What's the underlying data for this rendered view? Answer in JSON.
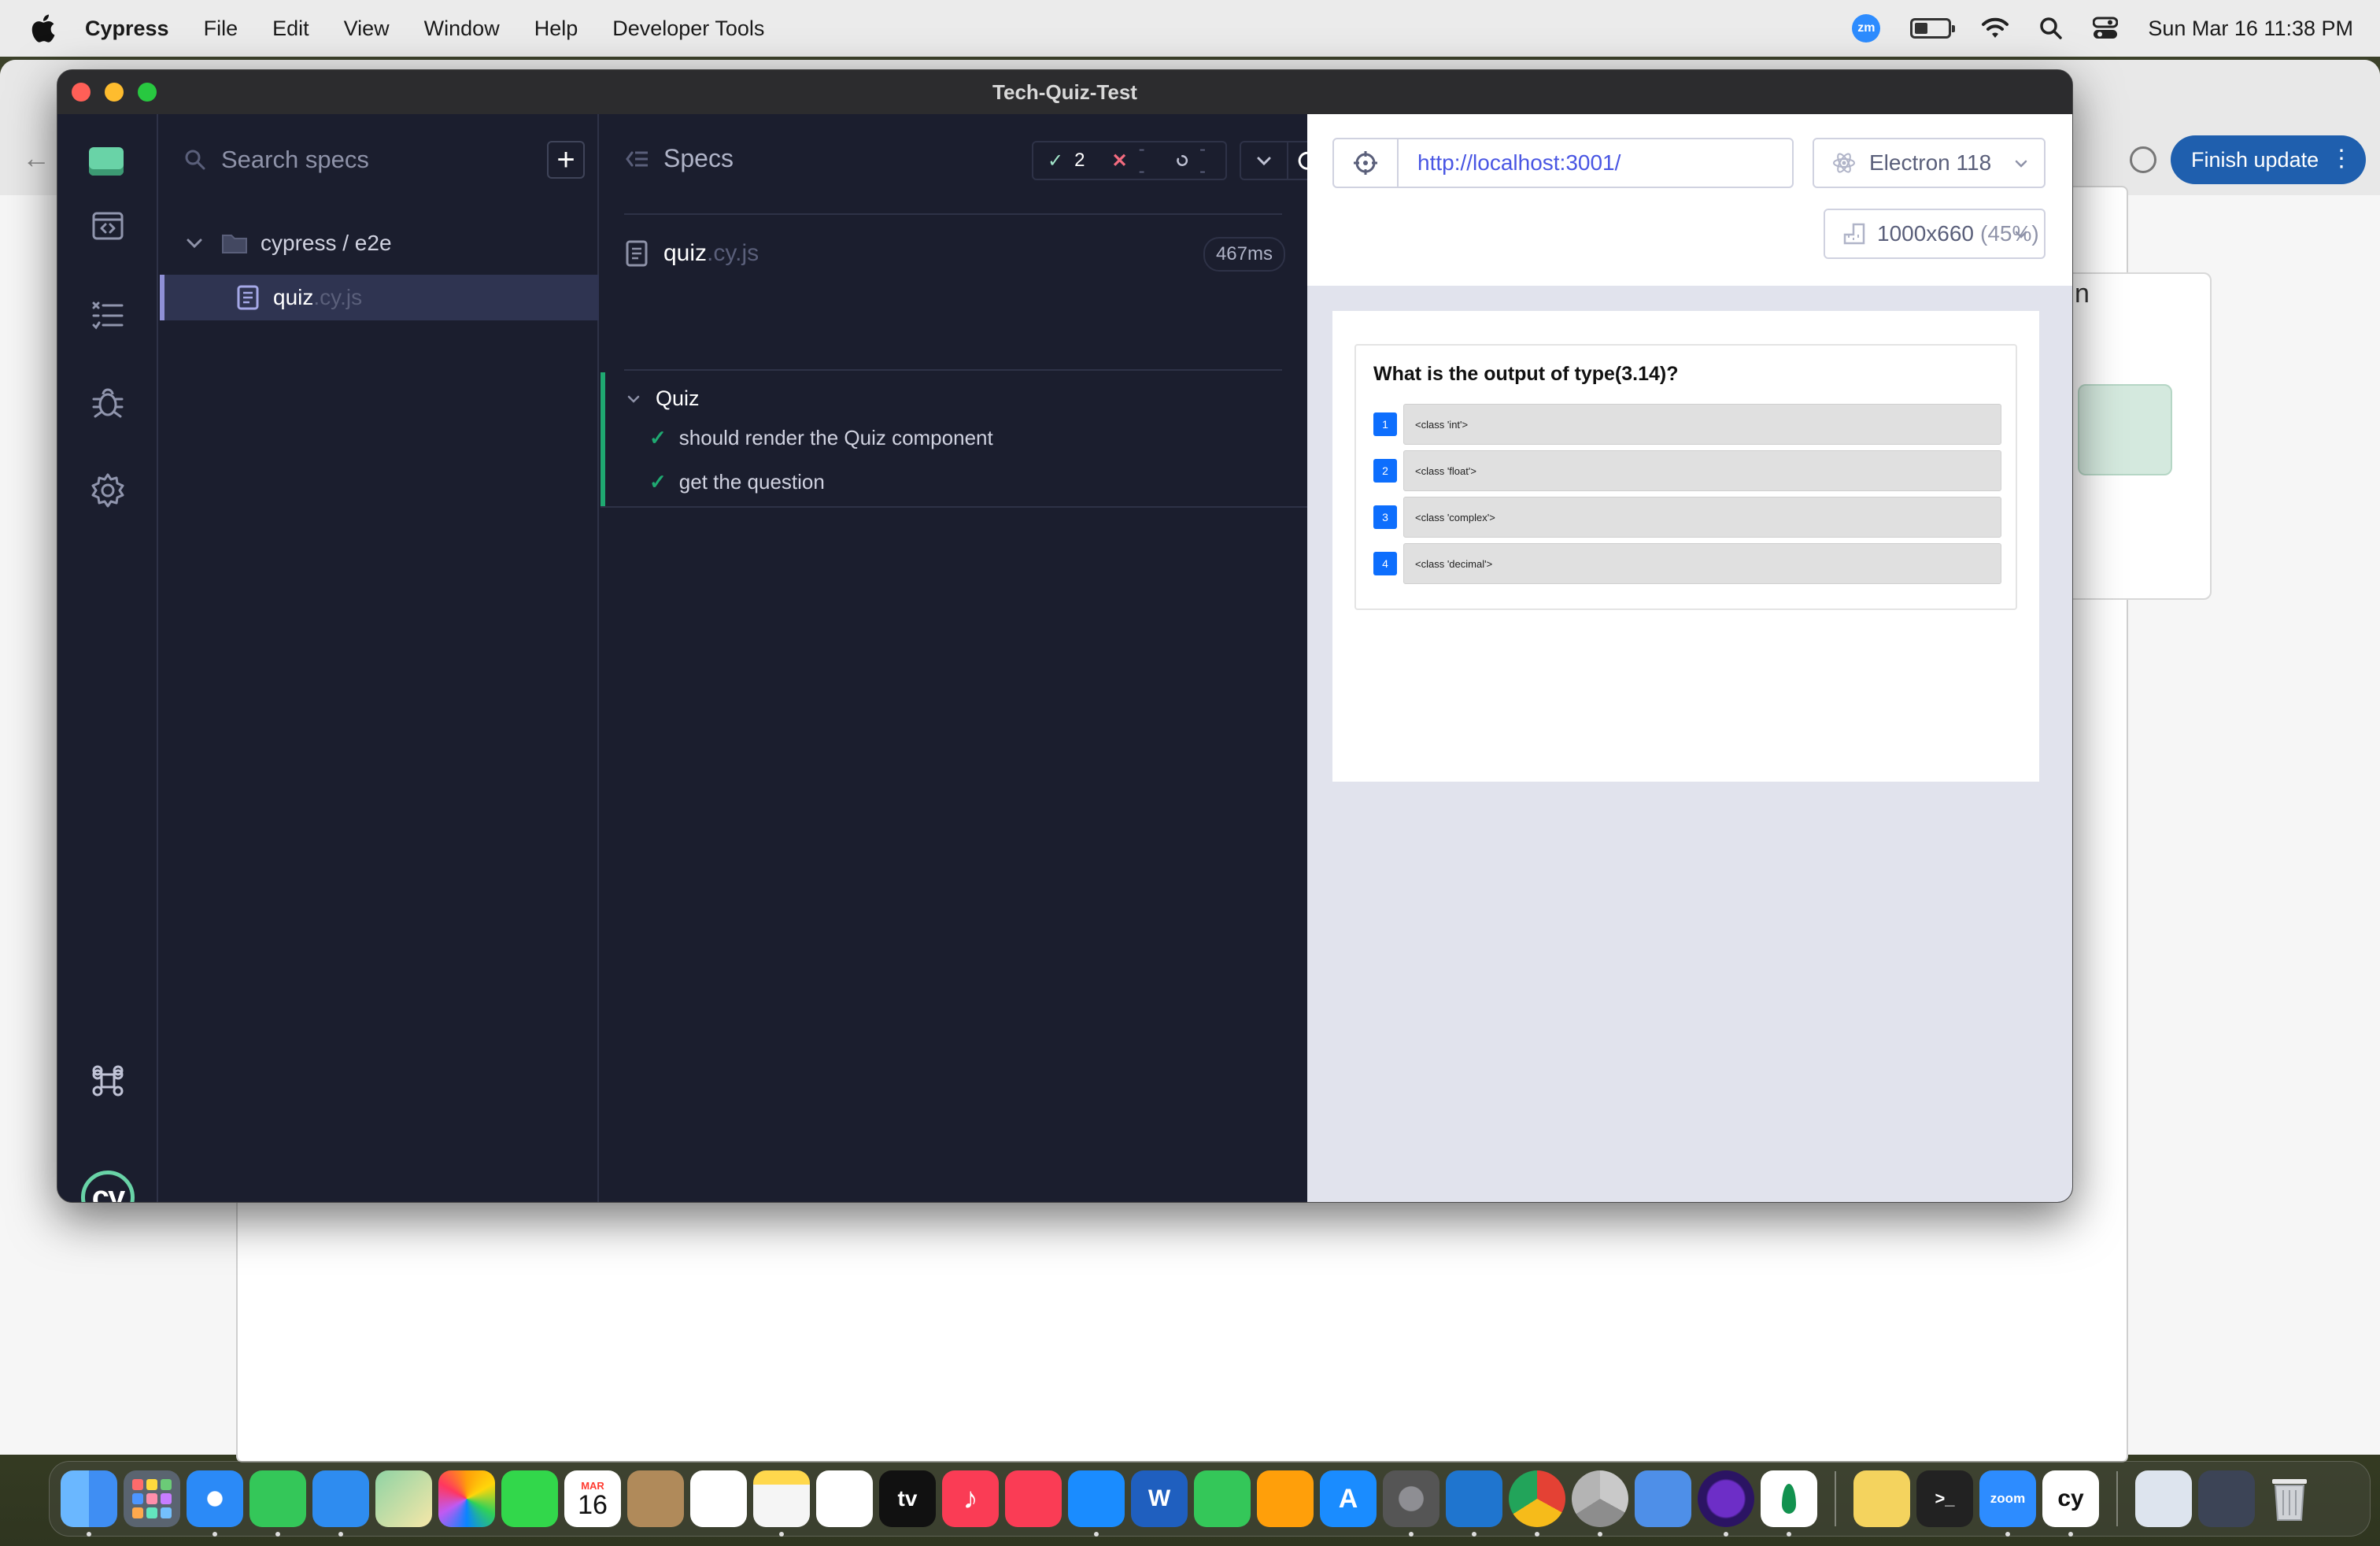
{
  "menubar": {
    "app_name": "Cypress",
    "items": [
      "File",
      "Edit",
      "View",
      "Window",
      "Help",
      "Developer Tools"
    ],
    "zoom_badge": "zm",
    "clock": "Sun Mar 16  11:38 PM"
  },
  "background_window": {
    "update_button": "Finish update",
    "partial_letter": "n"
  },
  "window": {
    "title": "Tech-Quiz-Test"
  },
  "nav": {
    "logo_text": "cy"
  },
  "specs_panel": {
    "search_placeholder": "Search specs",
    "add_label": "+",
    "folder": "cypress / e2e",
    "file_name": "quiz",
    "file_ext": ".cy.js"
  },
  "reporter": {
    "header": "Specs",
    "passed": "2",
    "failed": "--",
    "pending": "--",
    "spec_name": "quiz",
    "spec_ext": ".cy.js",
    "duration": "467ms",
    "suite": "Quiz",
    "tests": [
      "should render the Quiz component",
      "get the question"
    ]
  },
  "aut": {
    "url": "http://localhost:3001/",
    "browser": "Electron 118",
    "viewport": "1000x660",
    "scale": "(45%)",
    "question": "What is the output of type(3.14)?",
    "answers": [
      {
        "num": "1",
        "text": "<class 'int'>"
      },
      {
        "num": "2",
        "text": "<class 'float'>"
      },
      {
        "num": "3",
        "text": "<class 'complex'>"
      },
      {
        "num": "4",
        "text": "<class 'decimal'>"
      }
    ]
  },
  "dock": {
    "calendar_month": "MAR",
    "calendar_day": "16",
    "tv_label": "tv",
    "zoom_label": "zoom",
    "cy_label": "cy",
    "apps": [
      "finder",
      "launchpad",
      "safari",
      "messages",
      "mail",
      "maps",
      "photos",
      "facetime",
      "calendar",
      "contacts",
      "reminders",
      "notes",
      "freeform",
      "tv",
      "music",
      "news",
      "keynote",
      "word",
      "numbers",
      "pages",
      "app-store",
      "system-settings",
      "vscode",
      "chrome",
      "chrome-dev",
      "xcode",
      "tor",
      "mongodb",
      "stickies",
      "terminal",
      "zoom",
      "cypress",
      "archive",
      "downloads",
      "trash"
    ],
    "colors": {
      "finder": "#3f8ef3",
      "messages": "#34c759",
      "music": "#fa3c55",
      "vscode": "#1f75cf",
      "chrome": "#e44134",
      "zoom": "#2d8cff"
    }
  },
  "colors": {
    "cypress_bg": "#1b1e2e",
    "pass_green": "#1fa971",
    "fail_red": "#f36b7f",
    "url_blue": "#4956e3",
    "answer_blue": "#0d6efd"
  }
}
